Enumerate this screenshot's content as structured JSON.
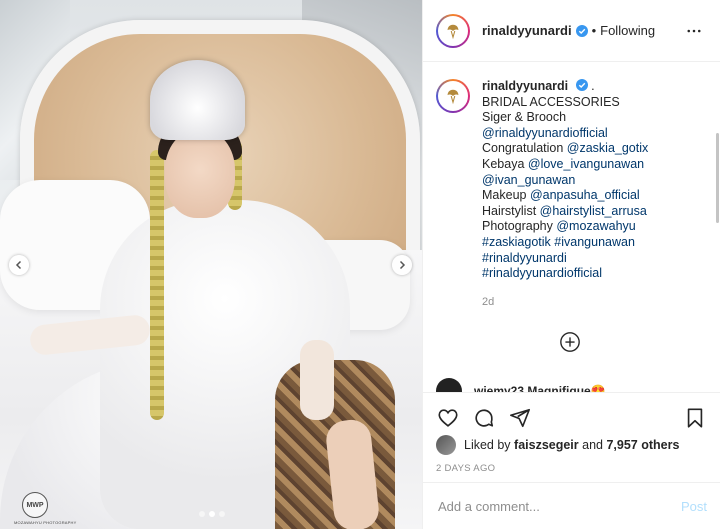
{
  "photo": {
    "watermark_badge": "MWP",
    "watermark_caption": "MOZAWAHYU PHOTOGRAPHY",
    "carousel_total": 3,
    "carousel_active": 2
  },
  "post": {
    "username": "rinaldyyunardi",
    "follow_state": "Following",
    "verified": true,
    "caption": {
      "username": "rinaldyyunardi",
      "after_username": ".",
      "lines": [
        {
          "parts": [
            {
              "text": "BRIDAL ACCESSORIES",
              "link": false
            }
          ]
        },
        {
          "parts": [
            {
              "text": "Siger & Brooch",
              "link": false
            }
          ]
        },
        {
          "parts": [
            {
              "text": "@rinaldyyunardiofficial",
              "link": true
            }
          ]
        },
        {
          "parts": [
            {
              "text": "Congratulation ",
              "link": false
            },
            {
              "text": "@zaskia_gotix",
              "link": true
            }
          ]
        },
        {
          "parts": [
            {
              "text": "Kebaya ",
              "link": false
            },
            {
              "text": "@love_ivangunawan",
              "link": true
            }
          ]
        },
        {
          "parts": [
            {
              "text": "@ivan_gunawan",
              "link": true
            }
          ]
        },
        {
          "parts": [
            {
              "text": "Makeup ",
              "link": false
            },
            {
              "text": "@anpasuha_official",
              "link": true
            }
          ]
        },
        {
          "parts": [
            {
              "text": "Hairstylist ",
              "link": false
            },
            {
              "text": "@hairstylist_arrusa",
              "link": true
            }
          ]
        },
        {
          "parts": [
            {
              "text": "Photography ",
              "link": false
            },
            {
              "text": "@mozawahyu",
              "link": true
            }
          ]
        },
        {
          "parts": [
            {
              "text": "#zaskiagotik",
              "link": true
            },
            {
              "text": " ",
              "link": false
            },
            {
              "text": "#ivangunawan",
              "link": true
            }
          ]
        },
        {
          "parts": [
            {
              "text": "#rinaldyyunardi",
              "link": true
            }
          ]
        },
        {
          "parts": [
            {
              "text": "#rinaldyyunardiofficial",
              "link": true
            }
          ]
        }
      ],
      "age": "2d"
    },
    "comment_peek": "wiemy23 Magnifique😍",
    "likes": {
      "prefix": "Liked by ",
      "user": "faiszsegeir",
      "middle": " and ",
      "count": "7,957 others"
    },
    "posted_ago": "2 DAYS AGO",
    "comment_placeholder": "Add a comment...",
    "post_label": "Post"
  },
  "icons": [
    "heart-icon",
    "comment-icon",
    "share-icon",
    "bookmark-icon",
    "more-icon",
    "plus-circle-icon",
    "verified-icon",
    "chevron-left-icon",
    "chevron-right-icon"
  ],
  "colors": {
    "link": "#00376b",
    "verified": "#3897f0",
    "post_disabled": "#b2dffc",
    "muted": "#8e8e8e"
  }
}
